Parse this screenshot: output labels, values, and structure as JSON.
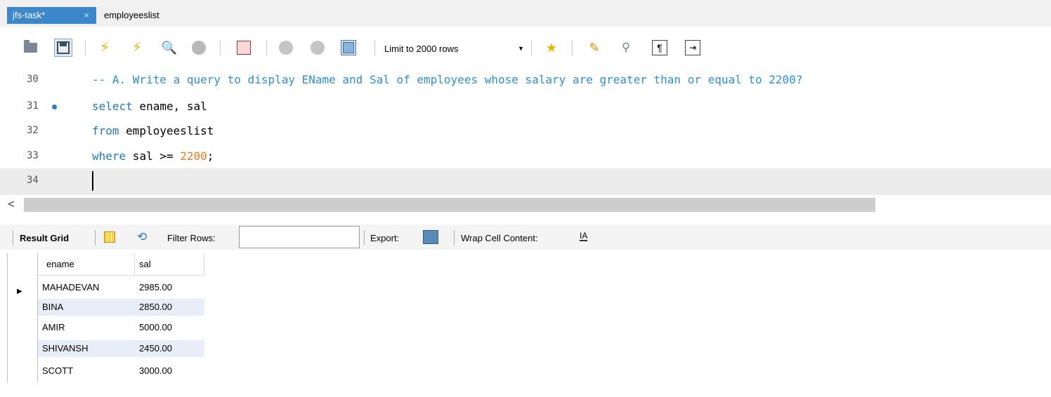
{
  "tabs": [
    {
      "label": "jfs-task*",
      "close": "×",
      "active": true
    },
    {
      "label": "employeeslist",
      "active": false
    }
  ],
  "toolbar": {
    "limit_label": "Limit to 2000 rows",
    "icons": [
      "open-folder-icon",
      "save-icon",
      "execute-icon",
      "execute-current-icon",
      "explain-icon",
      "stop-icon",
      "toggle-error-icon",
      "commit-icon",
      "rollback-icon",
      "autocommit-icon",
      "limit-dropdown",
      "add-snippet-icon",
      "beautify-icon",
      "find-icon",
      "invisible-chars-icon",
      "wrap-icon"
    ]
  },
  "editor": {
    "lines": [
      {
        "num": "30",
        "tokens": [
          {
            "t": "-- A. Write a query to display EName and Sal of employees whose salary are greater than or equal to 2200?",
            "c": "comment"
          }
        ]
      },
      {
        "num": "31",
        "breakpoint": true,
        "tokens": [
          {
            "t": "select",
            "c": "kw"
          },
          {
            "t": " ename, sal",
            "c": "plain"
          }
        ]
      },
      {
        "num": "32",
        "tokens": [
          {
            "t": "from",
            "c": "kw"
          },
          {
            "t": " employeeslist",
            "c": "plain"
          }
        ]
      },
      {
        "num": "33",
        "tokens": [
          {
            "t": "where",
            "c": "kw"
          },
          {
            "t": " sal >= ",
            "c": "plain"
          },
          {
            "t": "2200",
            "c": "num"
          },
          {
            "t": ";",
            "c": "plain"
          }
        ]
      },
      {
        "num": "34",
        "current": true,
        "tokens": []
      }
    ]
  },
  "scrollbar": {
    "left_arrow": "<"
  },
  "result_bar": {
    "result_grid_label": "Result Grid",
    "filter_label": "Filter Rows:",
    "filter_value": "",
    "export_label": "Export:",
    "wrap_label": "Wrap Cell Content:",
    "wrap_icon_text": "IA"
  },
  "grid": {
    "columns": [
      "ename",
      "sal"
    ],
    "rows": [
      [
        "MAHADEVAN",
        "2985.00"
      ],
      [
        "BINA",
        "2850.00"
      ],
      [
        "AMIR",
        "5000.00"
      ],
      [
        "SHIVANSH",
        "2450.00"
      ],
      [
        "SCOTT",
        "3000.00"
      ]
    ],
    "current_row_marker": "▶"
  }
}
